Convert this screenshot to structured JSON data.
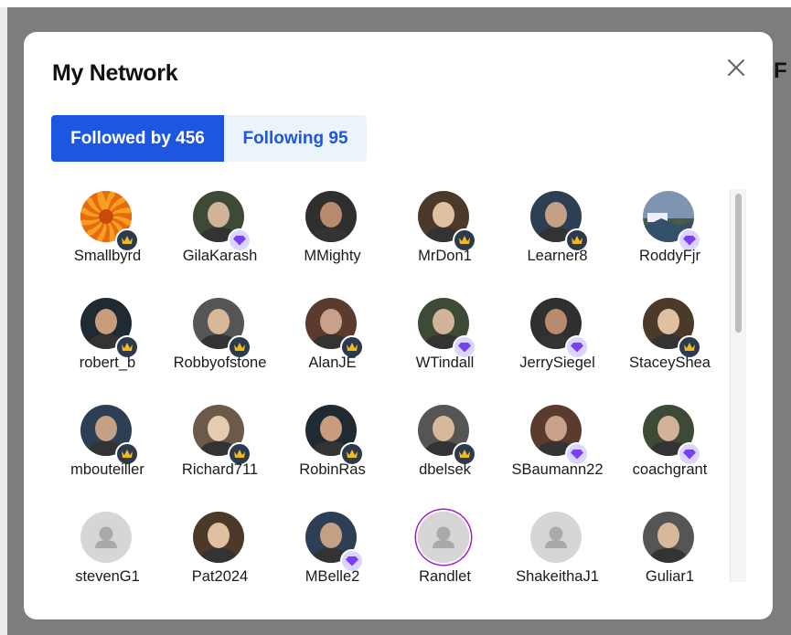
{
  "background": {
    "partial_heading": "F"
  },
  "modal": {
    "title": "My Network",
    "close_icon": "close-icon"
  },
  "tabs": [
    {
      "label": "Followed by 456",
      "active": true
    },
    {
      "label": "Following 95",
      "active": false
    }
  ],
  "users": [
    {
      "name": "Smallbyrd",
      "badge": "crown",
      "avatar": "orange-flower"
    },
    {
      "name": "GilaKarash",
      "badge": "gem",
      "avatar": "photo"
    },
    {
      "name": "MMighty",
      "badge": "none",
      "avatar": "photo"
    },
    {
      "name": "MrDon1",
      "badge": "crown",
      "avatar": "photo"
    },
    {
      "name": "Learner8",
      "badge": "crown",
      "avatar": "photo"
    },
    {
      "name": "RoddyFjr",
      "badge": "gem",
      "avatar": "landscape"
    },
    {
      "name": "robert_b",
      "badge": "crown",
      "avatar": "photo"
    },
    {
      "name": "Robbyofstone",
      "badge": "crown",
      "avatar": "photo"
    },
    {
      "name": "AlanJE",
      "badge": "crown",
      "avatar": "photo"
    },
    {
      "name": "WTindall",
      "badge": "gem",
      "avatar": "photo"
    },
    {
      "name": "JerrySiegel",
      "badge": "gem",
      "avatar": "photo"
    },
    {
      "name": "StaceyShea",
      "badge": "crown",
      "avatar": "photo"
    },
    {
      "name": "mbouteiller",
      "badge": "crown",
      "avatar": "photo"
    },
    {
      "name": "Richard711",
      "badge": "crown",
      "avatar": "photo"
    },
    {
      "name": "RobinRas",
      "badge": "crown",
      "avatar": "photo"
    },
    {
      "name": "dbelsek",
      "badge": "crown",
      "avatar": "photo"
    },
    {
      "name": "SBaumann22",
      "badge": "gem",
      "avatar": "photo"
    },
    {
      "name": "coachgrant",
      "badge": "gem",
      "avatar": "photo"
    },
    {
      "name": "stevenG1",
      "badge": "none",
      "avatar": "placeholder"
    },
    {
      "name": "Pat2024",
      "badge": "none",
      "avatar": "photo"
    },
    {
      "name": "MBelle2",
      "badge": "gem",
      "avatar": "photo"
    },
    {
      "name": "Randlet",
      "badge": "none",
      "avatar": "placeholder-ring"
    },
    {
      "name": "ShakeithaJ1",
      "badge": "none",
      "avatar": "placeholder"
    },
    {
      "name": "Guliar1",
      "badge": "none",
      "avatar": "photo"
    }
  ],
  "colors": {
    "primary": "#1d56e0",
    "tab_inactive_bg": "#eaf4fa",
    "crown_badge_bg": "#2b3a4d",
    "crown": "#f2b820",
    "gem_badge_bg": "#d9d5ff",
    "gem": "#7b3ff2"
  }
}
